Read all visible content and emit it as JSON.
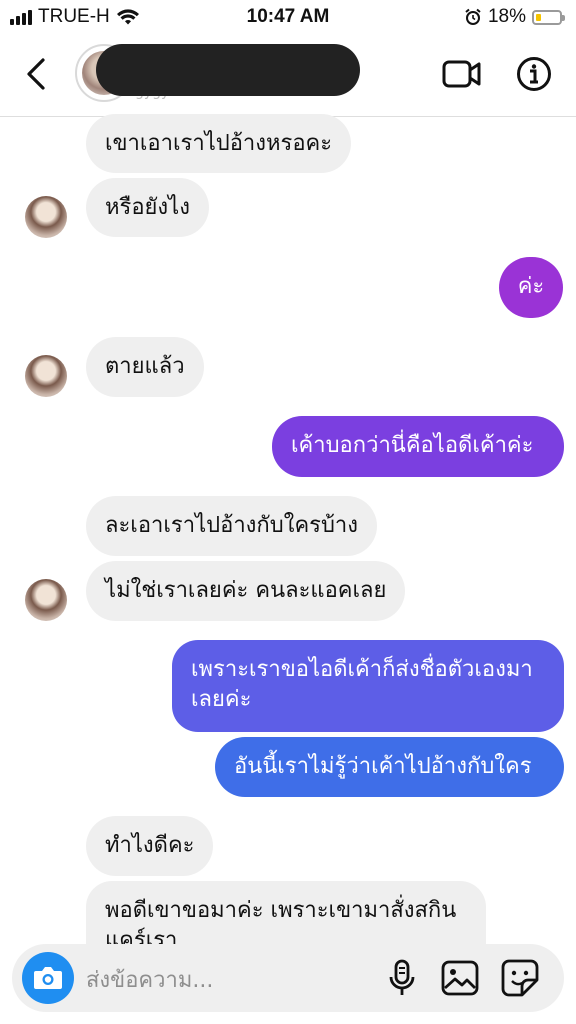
{
  "status": {
    "carrier": "TRUE-H",
    "time": "10:47 AM",
    "battery_pct": "18%",
    "battery_level": 0.18
  },
  "header": {
    "username_faint": "gygyaraa"
  },
  "messages": [
    {
      "side": "in",
      "text": "เขาเอาเราไปอ้างหรอคะ"
    },
    {
      "side": "in",
      "text": "หรือยังไง"
    },
    {
      "side": "out",
      "text": "ค่ะ"
    },
    {
      "side": "in",
      "text": "ตายแล้ว"
    },
    {
      "side": "out",
      "text": "เค้าบอกว่านี่คือไอดีเค้าค่ะ"
    },
    {
      "side": "in",
      "text": "ละเอาเราไปอ้างกับใครบ้าง"
    },
    {
      "side": "in",
      "text": "ไม่ใช่เราเลยค่ะ คนละแอคเลย"
    },
    {
      "side": "out",
      "text": "เพราะเราขอไอดีเค้าก็ส่งชื่อตัวเองมาเลยค่ะ"
    },
    {
      "side": "out",
      "text": "อันนี้เราไม่รู้ว่าเค้าไปอ้างกับใคร"
    },
    {
      "side": "in",
      "text": "ทำไงดีคะ"
    },
    {
      "side": "in",
      "text": "พอดีเขาขอมาค่ะ เพราะเขามาสั่งสกินแคร์เรา"
    }
  ],
  "composer": {
    "placeholder": "ส่งข้อความ..."
  },
  "colors": {
    "outgoing_1": "#9a33d6",
    "outgoing_2": "#7b3fe0",
    "outgoing_3": "#5d5ee7",
    "outgoing_4": "#3f6ee8",
    "incoming": "#efefef",
    "camera": "#1f8ef1"
  }
}
